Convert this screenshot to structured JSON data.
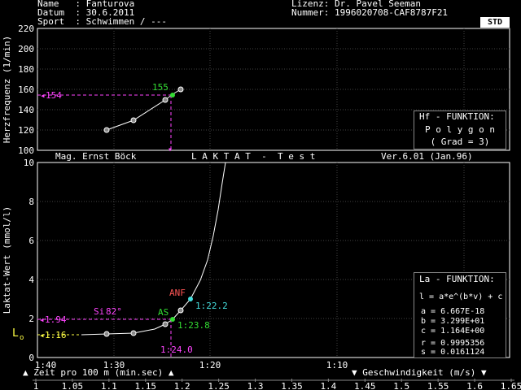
{
  "header": {
    "name_label": "Name   : ",
    "name_value": "Fanturova",
    "date_label": "Datum  : ",
    "date_value": "30.6.2011",
    "sport_label": "Sport  : ",
    "sport_value": "Schwimmen / ---",
    "license_label": "Lizenz: ",
    "license_value": "Dr. Pavel Seeman",
    "number_label": "Nummer: ",
    "number_value": "1996020708-CAF8787F21",
    "std_button": "STD"
  },
  "title_bar": {
    "left": "Mag. Ernst Böck",
    "center": "L A K T A T  -  T e s t",
    "right": "Ver.6.01 (Jan.96)"
  },
  "hf_panel": {
    "title": "Hf - FUNKTION:",
    "line1": "P o l y g o n",
    "line2": "( Grad = 3)"
  },
  "la_panel": {
    "title": "La - FUNKTION:",
    "formula": "l = a*e^(b*v) + c",
    "a": "a = 6.667E-18",
    "b": "b = 3.299E+01",
    "c": "c = 1.164E+00",
    "r": "r = 0.9995356",
    "s": "s = 0.0161124"
  },
  "top_chart": {
    "ylabel": "Herzfrequenz (1/min)",
    "yticks": [
      "100",
      "120",
      "140",
      "160",
      "180",
      "200",
      "220"
    ],
    "marker_value": "154",
    "marker_point_label": "155"
  },
  "bottom_chart": {
    "ylabel": "Laktat-Wert (mmol/l)",
    "yticks": [
      "0",
      "2",
      "4",
      "6",
      "8",
      "10"
    ],
    "xticks": [
      "1:40",
      "1:30",
      "1:20",
      "1:10"
    ],
    "markers": {
      "lo_label": "L",
      "lo_sub": "o",
      "lo_value": "1.16",
      "si_label": "Si",
      "si_value": "82°",
      "y194": "1.94",
      "as_label": "AS",
      "as_time": "1:23.8",
      "anf_label": "ANF",
      "anf_time": "1:22.2",
      "x_marker": "1:24.0"
    }
  },
  "footer": {
    "left_axis": "Zeit pro 100 m (min.sec)",
    "right_axis": "Geschwindigkeit (m/s)",
    "speed_ticks": [
      "1",
      "1.05",
      "1.1",
      "1.15",
      "1.2",
      "1.25",
      "1.3",
      "1.35",
      "1.4",
      "1.45",
      "1.5",
      "1.55",
      "1.6",
      "1.65"
    ]
  },
  "colors": {
    "grid": "#444444",
    "curve": "#ffffff",
    "magenta": "#ff44ff",
    "green": "#33dd33",
    "yellow": "#ffff44",
    "cyan": "#44dddd",
    "red": "#ff5555"
  },
  "chart_data": [
    {
      "type": "line",
      "title": "",
      "ylabel": "Herzfrequenz (1/min)",
      "ylim": [
        100,
        220
      ],
      "series": [
        {
          "x": [
            "1:31.4",
            "1:28.0",
            "1:24.6",
            "1:23.9",
            "1:23.0"
          ],
          "values": [
            120,
            130,
            148,
            155,
            160
          ]
        }
      ]
    },
    {
      "type": "line",
      "title": "L A K T A T  -  T e s t",
      "xlabel": "Zeit pro 100 m (min.sec)",
      "ylabel": "Laktat-Wert (mmol/l)",
      "ylim": [
        0,
        10
      ],
      "xlim": [
        "1:40",
        "1:05"
      ],
      "series": [
        {
          "x": [
            "1:31.4",
            "1:28.0",
            "1:24.6",
            "1:23.9",
            "1:23.0",
            "1:22.2"
          ],
          "values": [
            1.16,
            1.25,
            1.7,
            1.94,
            2.4,
            3.0
          ]
        }
      ]
    }
  ]
}
